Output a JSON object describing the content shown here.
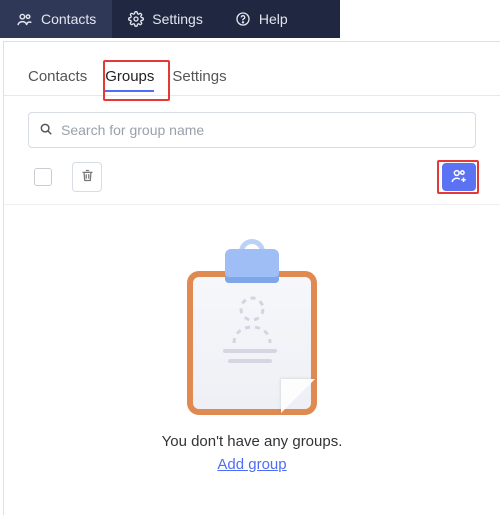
{
  "topnav": {
    "items": [
      {
        "label": "Contacts",
        "icon": "contacts-icon",
        "active": true
      },
      {
        "label": "Settings",
        "icon": "gear-icon",
        "active": false
      },
      {
        "label": "Help",
        "icon": "help-icon",
        "active": false
      }
    ]
  },
  "tabs": {
    "items": [
      {
        "label": "Contacts",
        "active": false
      },
      {
        "label": "Groups",
        "active": true
      },
      {
        "label": "Settings",
        "active": false
      }
    ]
  },
  "search": {
    "placeholder": "Search for group name",
    "value": ""
  },
  "toolbar": {
    "select_all_checked": false,
    "delete_label": "Delete",
    "add_group_label": "Add group"
  },
  "empty_state": {
    "message": "You don't have any groups.",
    "link": "Add group"
  },
  "highlights": {
    "groups_tab": true,
    "add_group_button": true
  },
  "colors": {
    "accent": "#4f6df5",
    "nav_bg": "#202841",
    "nav_active": "#2f3857",
    "highlight": "#e53935",
    "clipboard_border": "#e08a52"
  }
}
